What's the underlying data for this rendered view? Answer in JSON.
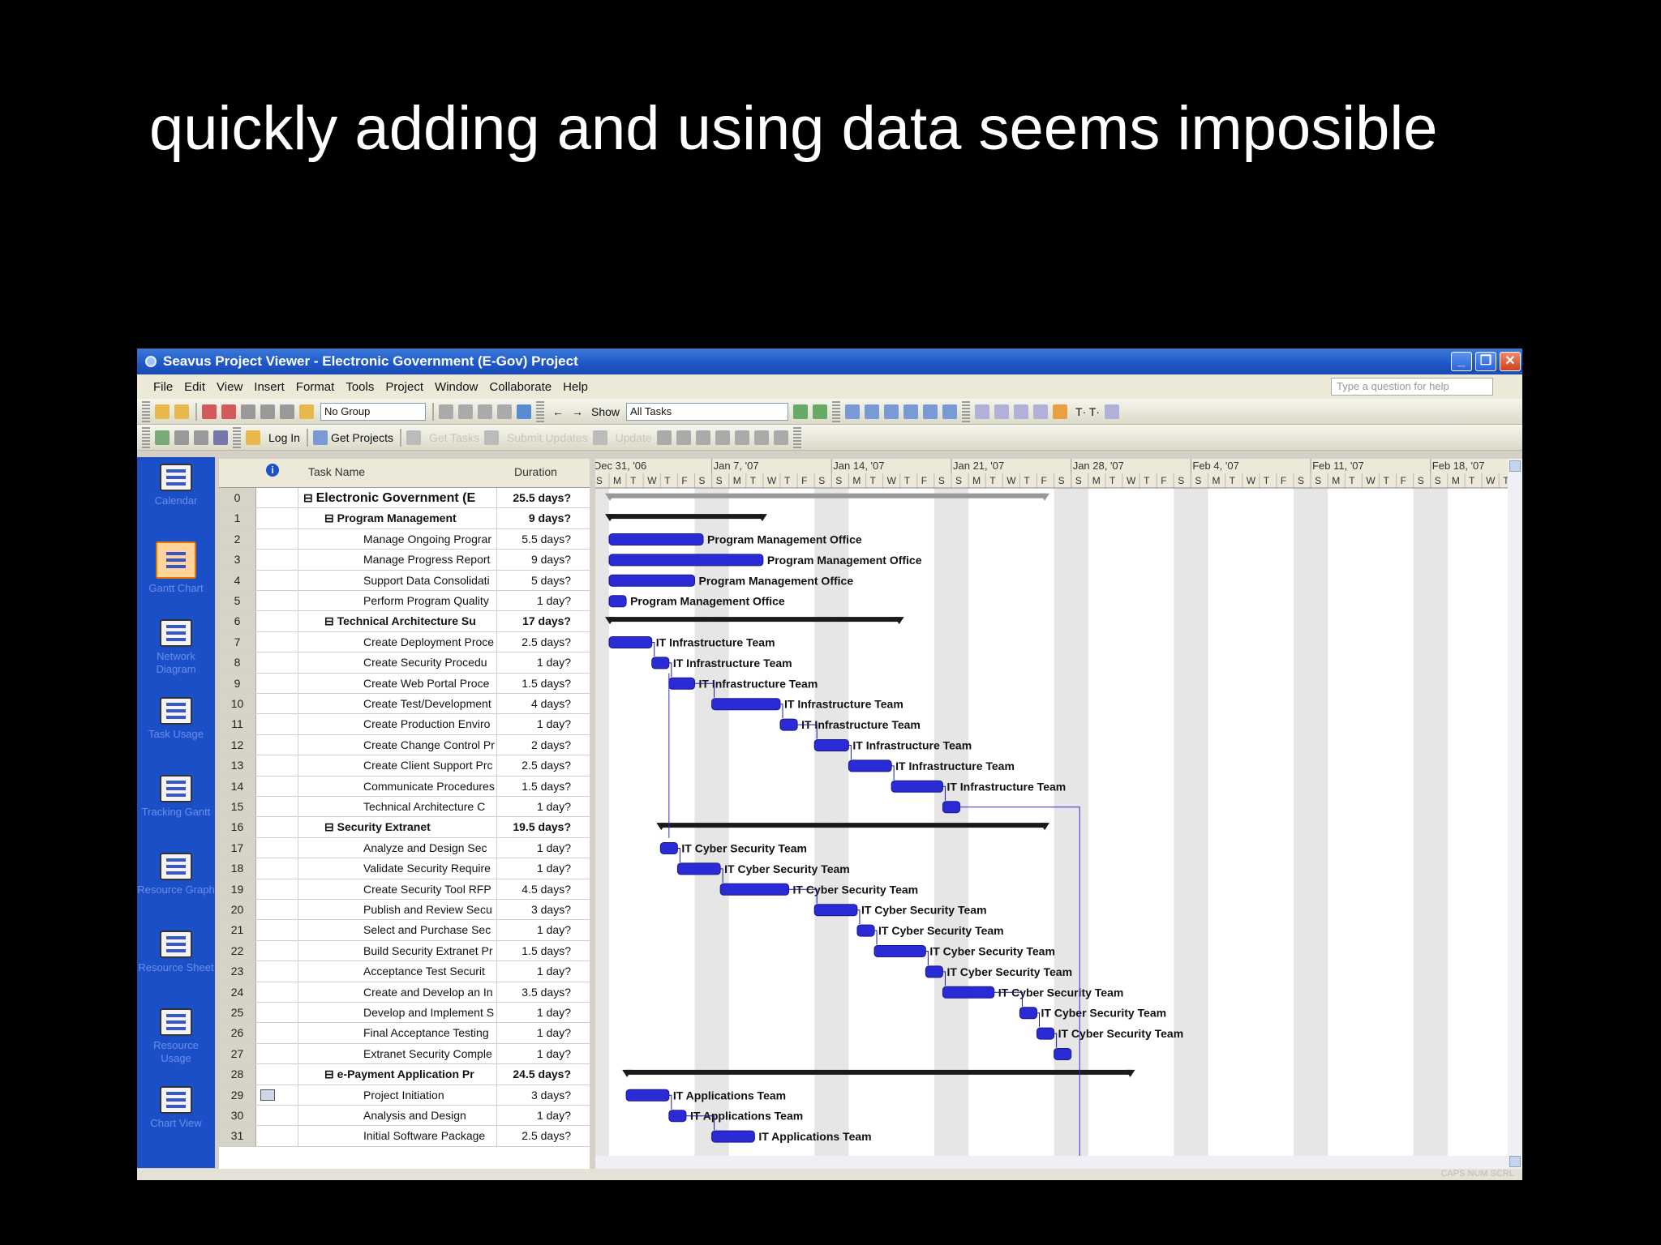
{
  "slide": {
    "title": "quickly adding and using data seems imposible"
  },
  "window": {
    "title": "Seavus Project Viewer - Electronic Government (E-Gov) Project"
  },
  "menu": [
    "File",
    "Edit",
    "View",
    "Insert",
    "Format",
    "Tools",
    "Project",
    "Window",
    "Collaborate",
    "Help"
  ],
  "help_placeholder": "Type a question for help",
  "toolbar1": {
    "group_select": "No Group",
    "show_label": "Show",
    "filter_select": "All Tasks"
  },
  "toolbar2": {
    "login": "Log In",
    "get_projects": "Get Projects",
    "get_tasks": "Get Tasks",
    "submit_updates": "Submit Updates",
    "update": "Update"
  },
  "viewbar": [
    {
      "label": "Calendar",
      "icon": "calendar-icon"
    },
    {
      "label": "Gantt Chart",
      "icon": "gantt-icon",
      "active": true
    },
    {
      "label": "Network Diagram",
      "icon": "network-icon"
    },
    {
      "label": "Task Usage",
      "icon": "task-usage-icon"
    },
    {
      "label": "Tracking Gantt",
      "icon": "tracking-gantt-icon"
    },
    {
      "label": "Resource Graph",
      "icon": "resource-graph-icon"
    },
    {
      "label": "Resource Sheet",
      "icon": "resource-sheet-icon"
    },
    {
      "label": "Resource Usage",
      "icon": "resource-usage-icon"
    },
    {
      "label": "Chart View",
      "icon": "chart-view-icon"
    }
  ],
  "columns": {
    "task_name": "Task Name",
    "duration": "Duration"
  },
  "timescale": {
    "weeks": [
      "Dec 31, '06",
      "Jan 7, '07",
      "Jan 14, '07",
      "Jan 21, '07",
      "Jan 28, '07",
      "Feb 4, '07",
      "Feb 11, '07",
      "Feb 18, '07"
    ],
    "days": [
      "S",
      "M",
      "T",
      "W",
      "T",
      "F",
      "S"
    ]
  },
  "tasks": [
    {
      "id": "0",
      "name": "Electronic Government (E",
      "duration": "25.5 days?",
      "summary": true,
      "level": 0,
      "start": 0,
      "dur": 25.5
    },
    {
      "id": "1",
      "name": "Program Management",
      "duration": "9 days?",
      "summary": true,
      "level": 1,
      "start": 0,
      "dur": 9
    },
    {
      "id": "2",
      "name": "Manage Ongoing Prograr",
      "duration": "5.5 days?",
      "level": 2,
      "start": 0,
      "dur": 5.5,
      "resource": "Program Management Office"
    },
    {
      "id": "3",
      "name": "Manage Progress Report",
      "duration": "9 days?",
      "level": 2,
      "start": 0,
      "dur": 9,
      "resource": "Program Management Office"
    },
    {
      "id": "4",
      "name": "Support Data Consolidati",
      "duration": "5 days?",
      "level": 2,
      "start": 0,
      "dur": 5,
      "resource": "Program Management Office"
    },
    {
      "id": "5",
      "name": "Perform Program Quality",
      "duration": "1 day?",
      "level": 2,
      "start": 0,
      "dur": 1,
      "resource": "Program Management Office"
    },
    {
      "id": "6",
      "name": "Technical Architecture Su",
      "duration": "17 days?",
      "summary": true,
      "level": 1,
      "start": 0,
      "dur": 17
    },
    {
      "id": "7",
      "name": "Create Deployment Proce",
      "duration": "2.5 days?",
      "level": 2,
      "start": 0,
      "dur": 2.5,
      "resource": "IT Infrastructure Team"
    },
    {
      "id": "8",
      "name": "Create Security Procedu",
      "duration": "1 day?",
      "level": 2,
      "start": 2.5,
      "dur": 1,
      "resource": "IT Infrastructure Team"
    },
    {
      "id": "9",
      "name": "Create Web Portal Proce",
      "duration": "1.5 days?",
      "level": 2,
      "start": 3.5,
      "dur": 1.5,
      "resource": "IT Infrastructure Team"
    },
    {
      "id": "10",
      "name": "Create Test/Development",
      "duration": "4 days?",
      "level": 2,
      "start": 6,
      "dur": 4,
      "resource": "IT Infrastructure Team"
    },
    {
      "id": "11",
      "name": "Create Production Enviro",
      "duration": "1 day?",
      "level": 2,
      "start": 10,
      "dur": 1,
      "resource": "IT Infrastructure Team"
    },
    {
      "id": "12",
      "name": "Create Change Control Pr",
      "duration": "2 days?",
      "level": 2,
      "start": 12,
      "dur": 2,
      "resource": "IT Infrastructure Team"
    },
    {
      "id": "13",
      "name": "Create Client Support Prc",
      "duration": "2.5 days?",
      "level": 2,
      "start": 14,
      "dur": 2.5,
      "resource": "IT Infrastructure Team"
    },
    {
      "id": "14",
      "name": "Communicate Procedures",
      "duration": "1.5 days?",
      "level": 2,
      "start": 16.5,
      "dur": 3,
      "resource": "IT Infrastructure Team"
    },
    {
      "id": "15",
      "name": "Technical Architecture C",
      "duration": "1 day?",
      "level": 2,
      "start": 19.5,
      "dur": 1,
      "resource": ""
    },
    {
      "id": "16",
      "name": "Security Extranet",
      "duration": "19.5 days?",
      "summary": true,
      "level": 1,
      "start": 3,
      "dur": 22.5
    },
    {
      "id": "17",
      "name": "Analyze and Design Sec",
      "duration": "1 day?",
      "level": 2,
      "start": 3,
      "dur": 1,
      "resource": "IT Cyber Security Team"
    },
    {
      "id": "18",
      "name": "Validate Security Require",
      "duration": "1 day?",
      "level": 2,
      "start": 4,
      "dur": 2.5,
      "resource": "IT Cyber Security Team"
    },
    {
      "id": "19",
      "name": "Create Security Tool RFP",
      "duration": "4.5 days?",
      "level": 2,
      "start": 6.5,
      "dur": 4,
      "resource": "IT Cyber Security Team"
    },
    {
      "id": "20",
      "name": "Publish and Review Secu",
      "duration": "3 days?",
      "level": 2,
      "start": 12,
      "dur": 2.5,
      "resource": "IT Cyber Security Team"
    },
    {
      "id": "21",
      "name": "Select and Purchase Sec",
      "duration": "1 day?",
      "level": 2,
      "start": 14.5,
      "dur": 1,
      "resource": "IT Cyber Security Team"
    },
    {
      "id": "22",
      "name": "Build Security Extranet Pr",
      "duration": "1.5 days?",
      "level": 2,
      "start": 15.5,
      "dur": 3,
      "resource": "IT Cyber Security Team"
    },
    {
      "id": "23",
      "name": "Acceptance Test Securit",
      "duration": "1 day?",
      "level": 2,
      "start": 18.5,
      "dur": 1,
      "resource": "IT Cyber Security Team"
    },
    {
      "id": "24",
      "name": "Create and Develop an In",
      "duration": "3.5 days?",
      "level": 2,
      "start": 19.5,
      "dur": 3,
      "resource": "IT Cyber Security Team"
    },
    {
      "id": "25",
      "name": "Develop and Implement S",
      "duration": "1 day?",
      "level": 2,
      "start": 24,
      "dur": 1,
      "resource": "IT Cyber Security Team"
    },
    {
      "id": "26",
      "name": "Final Acceptance Testing",
      "duration": "1 day?",
      "level": 2,
      "start": 25,
      "dur": 1,
      "resource": "IT Cyber Security Team"
    },
    {
      "id": "27",
      "name": "Extranet Security Comple",
      "duration": "1 day?",
      "level": 2,
      "start": 26,
      "dur": 1,
      "resource": ""
    },
    {
      "id": "28",
      "name": "e-Payment Application Pr",
      "duration": "24.5 days?",
      "summary": true,
      "level": 1,
      "start": 1,
      "dur": 29.5
    },
    {
      "id": "29",
      "name": "Project Initiation",
      "duration": "3 days?",
      "level": 2,
      "start": 1,
      "dur": 2.5,
      "resource": "IT Applications Team",
      "note": true
    },
    {
      "id": "30",
      "name": "Analysis and Design",
      "duration": "1 day?",
      "level": 2,
      "start": 3.5,
      "dur": 1,
      "resource": "IT Applications Team"
    },
    {
      "id": "31",
      "name": "Initial Software Package",
      "duration": "2.5 days?",
      "level": 2,
      "start": 6,
      "dur": 2.5,
      "resource": "IT Applications Team"
    }
  ],
  "colors": {
    "bar": "#2b2bd6",
    "summary": "#1a1a1a",
    "viewbar": "#1b4fc8",
    "titlebar": "#1e56c8"
  },
  "statusbar": "CAPS NUM SCRL"
}
